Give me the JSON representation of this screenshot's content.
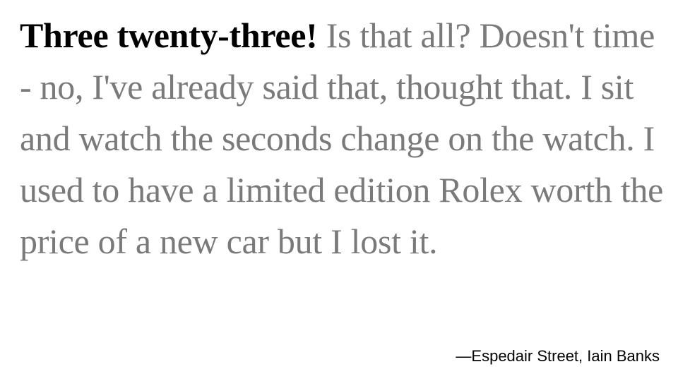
{
  "quote": {
    "lead": "Three twenty-three!",
    "body": "Is that all? Doesn't time - no, I've already said that, thought that. I sit and watch the seconds change on the watch. I used to have a limited edition Rolex worth the price of a new car but I lost it."
  },
  "attribution": "—Espedair Street, Iain Banks",
  "colors": {
    "lead_text": "#000000",
    "body_text": "#7a7a7a",
    "background": "#ffffff"
  }
}
